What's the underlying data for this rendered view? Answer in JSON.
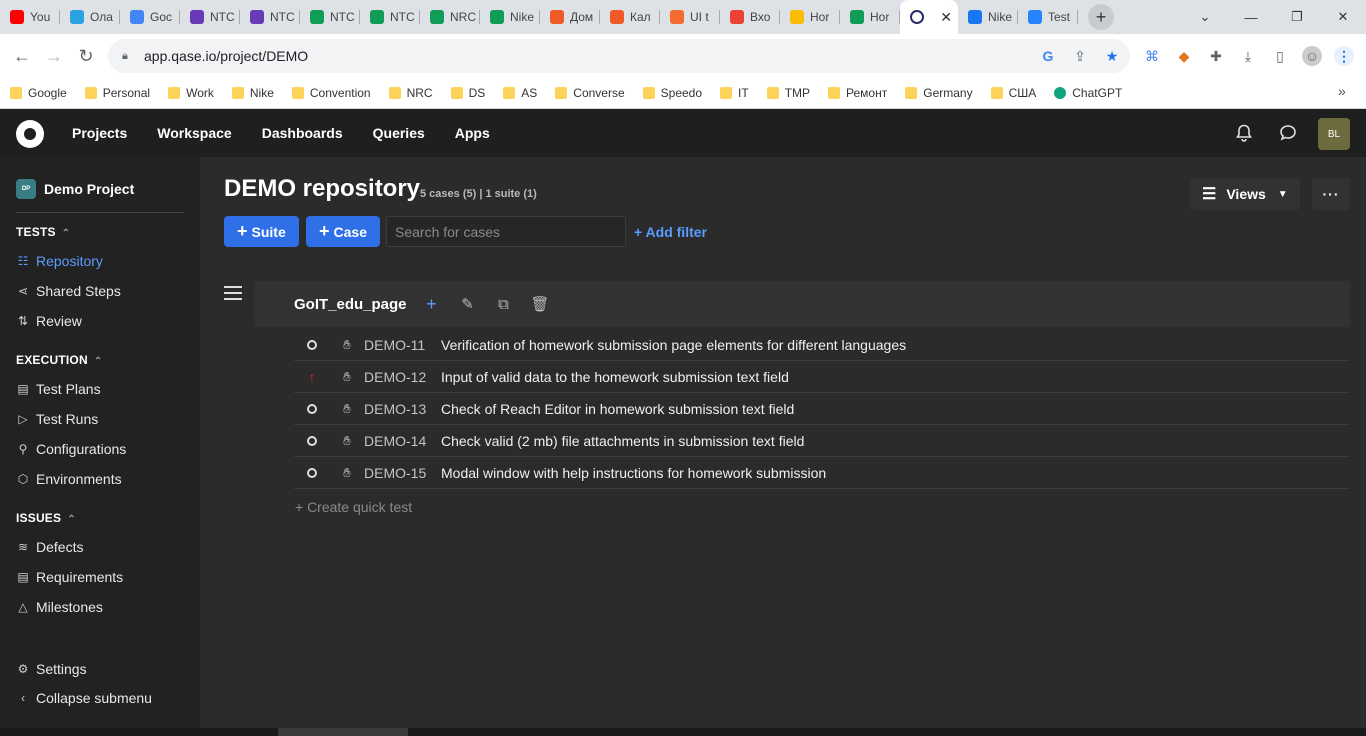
{
  "browser": {
    "tabs": [
      {
        "label": "You",
        "icon": "youtube-icon",
        "color": "#ff0000"
      },
      {
        "label": "Ола",
        "icon": "telegram-icon",
        "color": "#2aa3e0"
      },
      {
        "label": "Goc",
        "icon": "google-calendar-icon",
        "color": "#4285f4"
      },
      {
        "label": "NTC",
        "icon": "forms-icon",
        "color": "#673ab7"
      },
      {
        "label": "NTC",
        "icon": "forms-icon",
        "color": "#673ab7"
      },
      {
        "label": "NTC",
        "icon": "sheets-icon",
        "color": "#0f9d58"
      },
      {
        "label": "NTC",
        "icon": "sheets-icon",
        "color": "#0f9d58"
      },
      {
        "label": "NRC",
        "icon": "sheets-icon",
        "color": "#0f9d58"
      },
      {
        "label": "Nike",
        "icon": "sheets-icon",
        "color": "#0f9d58"
      },
      {
        "label": "Дом",
        "icon": "ozon-icon",
        "color": "#f05a28"
      },
      {
        "label": "Кал",
        "icon": "ozon-icon",
        "color": "#f05a28"
      },
      {
        "label": "UI t",
        "icon": "orange-circle-icon",
        "color": "#f36b2d"
      },
      {
        "label": "Вхо",
        "icon": "gmail-icon",
        "color": "#ea4335"
      },
      {
        "label": "Hor",
        "icon": "drive-icon",
        "color": "#fbbc04"
      },
      {
        "label": "Hor",
        "icon": "sheets-icon",
        "color": "#0f9d58"
      },
      {
        "label": "",
        "icon": "qase-icon",
        "color": "#2b2b6b",
        "active": true
      },
      {
        "label": "Nike",
        "icon": "facebook-icon",
        "color": "#1877f2"
      },
      {
        "label": "Test",
        "icon": "jira-icon",
        "color": "#2684ff"
      }
    ],
    "url": "app.qase.io/project/DEMO",
    "bookmarks": [
      "Google",
      "Personal",
      "Work",
      "Nike",
      "Convention",
      "NRC",
      "DS",
      "AS",
      "Converse",
      "Speedo",
      "IT",
      "TMP",
      "Ремонт",
      "Germany",
      "США",
      "ChatGPT"
    ]
  },
  "app": {
    "nav": [
      "Projects",
      "Workspace",
      "Dashboards",
      "Queries",
      "Apps"
    ],
    "avatar_initials": "BL"
  },
  "sidebar": {
    "project_name": "Demo Project",
    "project_badge": "DP",
    "sections": [
      {
        "title": "TESTS",
        "items": [
          {
            "label": "Repository",
            "icon": "repository-icon",
            "active": true
          },
          {
            "label": "Shared Steps",
            "icon": "shared-steps-icon"
          },
          {
            "label": "Review",
            "icon": "review-icon"
          }
        ]
      },
      {
        "title": "EXECUTION",
        "items": [
          {
            "label": "Test Plans",
            "icon": "test-plans-icon"
          },
          {
            "label": "Test Runs",
            "icon": "play-icon"
          },
          {
            "label": "Configurations",
            "icon": "wrench-icon"
          },
          {
            "label": "Environments",
            "icon": "cube-icon"
          }
        ]
      },
      {
        "title": "ISSUES",
        "items": [
          {
            "label": "Defects",
            "icon": "defects-icon"
          },
          {
            "label": "Requirements",
            "icon": "requirements-icon"
          },
          {
            "label": "Milestones",
            "icon": "milestone-icon"
          }
        ]
      }
    ],
    "settings": "Settings",
    "collapse": "Collapse submenu"
  },
  "main": {
    "title": "DEMO repository",
    "subinfo": "5 cases (5) | 1 suite (1)",
    "views_label": "Views",
    "suite_button": "Suite",
    "case_button": "Case",
    "search_placeholder": "Search for cases",
    "add_filter": "+ Add filter",
    "suite": {
      "name": "GoIT_edu_page",
      "cases": [
        {
          "id": "DEMO-11",
          "title": "Verification of homework submission page elements for different languages",
          "priority": "normal"
        },
        {
          "id": "DEMO-12",
          "title": "Input of valid data to the homework submission text field",
          "priority": "high"
        },
        {
          "id": "DEMO-13",
          "title": "Check of Reach Editor in homework submission text field",
          "priority": "normal"
        },
        {
          "id": "DEMO-14",
          "title": "Check valid (2 mb) file attachments in submission text field",
          "priority": "normal"
        },
        {
          "id": "DEMO-15",
          "title": "Modal window with help instructions for homework submission",
          "priority": "normal"
        }
      ]
    },
    "quick_test": "+ Create quick test"
  }
}
